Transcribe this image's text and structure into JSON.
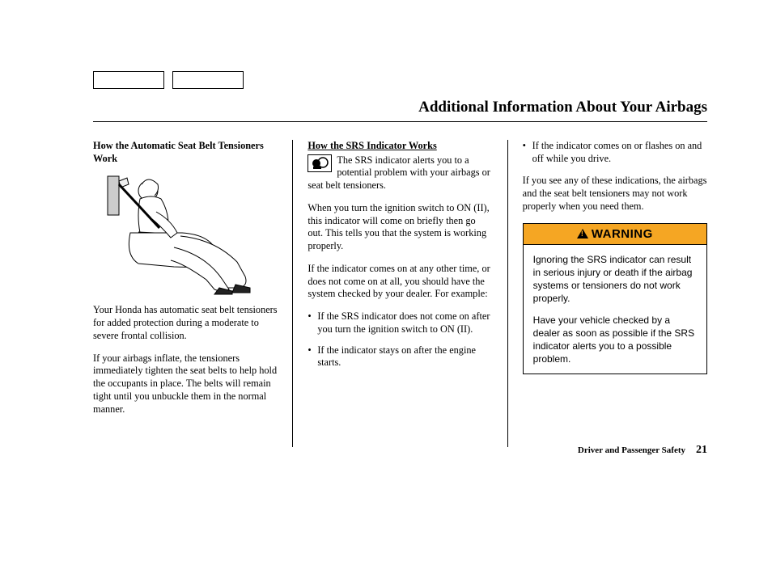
{
  "page_title": "Additional Information About Your Airbags",
  "col1": {
    "heading": "How the Automatic Seat Belt Tensioners Work",
    "p1": "Your Honda has automatic seat belt tensioners for added protection during a moderate to severe frontal collision.",
    "p2": "If your airbags inflate, the tensioners immediately tighten the seat belts to help hold the occupants in place. The belts will remain tight until you unbuckle them in the normal manner."
  },
  "col2": {
    "heading": "How the SRS Indicator Works",
    "p1": "The SRS indicator alerts you to a potential problem with your airbags or seat belt tensioners.",
    "p2": "When you turn the ignition switch to ON (II), this indicator will come on briefly then go out. This tells you that the system is working properly.",
    "p3": "If the indicator comes on at any other time, or does not come on at all, you should have the system checked by your dealer. For example:",
    "b1": "If the SRS indicator does not come on after you turn the ignition switch to ON (II).",
    "b2": "If the indicator stays on after the engine starts."
  },
  "col3": {
    "b1": "If the indicator comes on or flashes on and off while you drive.",
    "p1": "If you see any of these indications, the airbags and the seat belt tensioners may not work properly when you need them.",
    "warning_label": "WARNING",
    "w1": "Ignoring the SRS indicator can result in serious injury or death if the airbag systems or tensioners do not work properly.",
    "w2": "Have your vehicle checked by a dealer as soon as possible if the SRS indicator alerts you to a possible problem."
  },
  "footer": {
    "section": "Driver and Passenger Safety",
    "page": "21"
  }
}
